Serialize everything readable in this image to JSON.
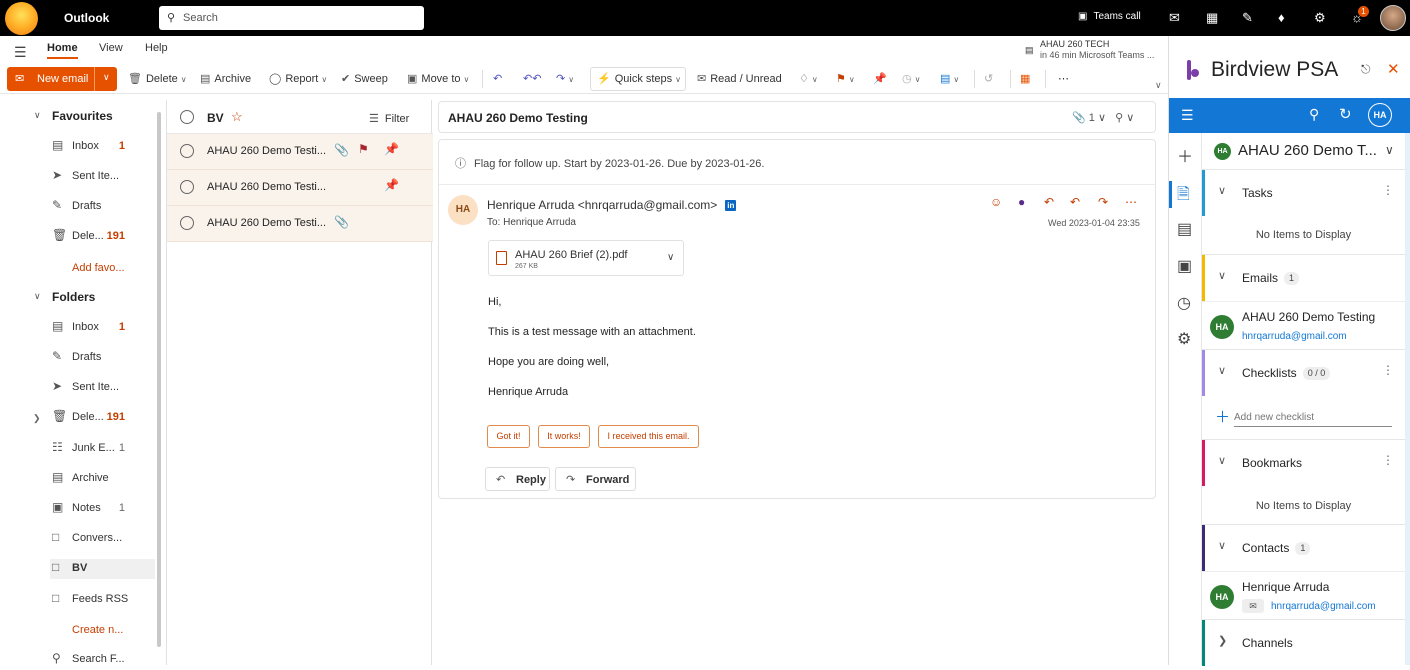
{
  "topbar": {
    "app_name": "Outlook",
    "search_placeholder": "Search",
    "teams_call": "Teams call",
    "notification_badge": "1"
  },
  "menu": {
    "tabs": [
      "Home",
      "View",
      "Help"
    ],
    "active": "Home"
  },
  "notice": {
    "line1": "AHAU 260 TECH",
    "line2": "in 46 min Microsoft Teams ..."
  },
  "ribbon": {
    "new_email": "New email",
    "delete": "Delete",
    "archive": "Archive",
    "report": "Report",
    "sweep": "Sweep",
    "move_to": "Move to",
    "quick_steps": "Quick steps",
    "read_unread": "Read / Unread"
  },
  "nav": {
    "favourites_header": "Favourites",
    "favourites": [
      {
        "label": "Inbox",
        "count": "1",
        "icon": "inbox-icon"
      },
      {
        "label": "Sent Ite...",
        "count": "",
        "icon": "send-icon"
      },
      {
        "label": "Drafts",
        "count": "",
        "icon": "pencil-icon"
      },
      {
        "label": "Dele...",
        "count": "191",
        "icon": "trash-icon"
      }
    ],
    "add_favourite": "Add favo...",
    "folders_header": "Folders",
    "folders": [
      {
        "label": "Inbox",
        "count": "1",
        "icon": "inbox-icon"
      },
      {
        "label": "Drafts",
        "count": "",
        "icon": "pencil-icon"
      },
      {
        "label": "Sent Ite...",
        "count": "",
        "icon": "send-icon"
      },
      {
        "label": "Dele...",
        "count": "191",
        "icon": "trash-icon"
      },
      {
        "label": "Junk E...",
        "count": "1",
        "icon": "junk-icon"
      },
      {
        "label": "Archive",
        "count": "",
        "icon": "archive-icon"
      },
      {
        "label": "Notes",
        "count": "1",
        "icon": "note-icon"
      },
      {
        "label": "Convers...",
        "count": "",
        "icon": "folder-icon"
      },
      {
        "label": "BV",
        "count": "",
        "icon": "folder-icon"
      },
      {
        "label": "Feeds RSS",
        "count": "",
        "icon": "folder-icon"
      }
    ],
    "create_new": "Create n...",
    "search_folders": "Search F..."
  },
  "message_list": {
    "folder_name": "BV",
    "filter_label": "Filter",
    "messages": [
      {
        "subject": "AHAU 260 Demo Testi...",
        "attachment": true,
        "flagged": true,
        "pinned": true
      },
      {
        "subject": "AHAU 260 Demo Testi...",
        "attachment": false,
        "flagged": false,
        "pinned": true
      },
      {
        "subject": "AHAU 260 Demo Testi...",
        "attachment": true,
        "flagged": false,
        "pinned": false
      }
    ]
  },
  "reading": {
    "subject": "AHAU 260 Demo Testing",
    "attach_count": "1",
    "flag_note": "Flag for follow up. Start by 2023-01-26. Due by 2023-01-26.",
    "sender_initials": "HA",
    "from": "Henrique Arruda <hnrqarruda@gmail.com>",
    "to": "To:  Henrique Arruda",
    "date": "Wed 2023-01-04 23:35",
    "attachment_name": "AHAU 260 Brief (2).pdf",
    "attachment_size": "267 KB",
    "body": [
      "Hi,",
      "This is a test message with an attachment.",
      "Hope you are doing well,",
      "Henrique Arruda"
    ],
    "suggestions": [
      "Got it!",
      "It works!",
      "I received this email."
    ],
    "reply": "Reply",
    "forward": "Forward"
  },
  "birdview": {
    "title": "Birdview PSA",
    "user_initials": "HA",
    "project_initials": "HA",
    "project_name": "AHAU 260 Demo T...",
    "sections": {
      "tasks": {
        "title": "Tasks",
        "empty": "No Items to Display",
        "color": "#1c9bd6"
      },
      "emails": {
        "title": "Emails",
        "count": "1",
        "color": "#f5b800",
        "record": {
          "initials": "HA",
          "name": "AHAU 260 Demo Testing",
          "link": "hnrqarruda@gmail.com"
        }
      },
      "checklists": {
        "title": "Checklists",
        "count": "0 / 0",
        "color": "#a488e8",
        "add_placeholder": "Add new checklist"
      },
      "bookmarks": {
        "title": "Bookmarks",
        "empty": "No Items to Display",
        "color": "#d81b60"
      },
      "contacts": {
        "title": "Contacts",
        "count": "1",
        "color": "#3f2a78",
        "record": {
          "initials": "HA",
          "name": "Henrique Arruda",
          "link": "hnrqarruda@gmail.com"
        }
      },
      "channels": {
        "title": "Channels",
        "color": "#00897b"
      }
    }
  }
}
